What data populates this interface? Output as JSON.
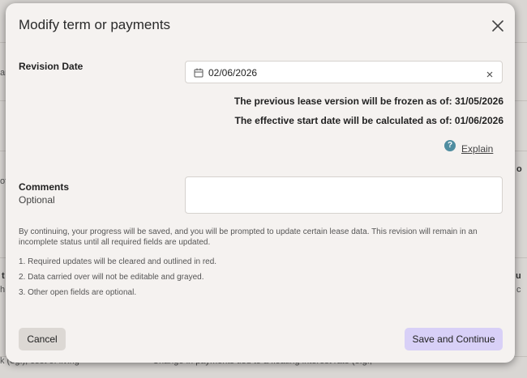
{
  "background": {
    "fragments": [
      "ar",
      "of",
      "t",
      "h",
      "o",
      "u",
      "c",
      "k (eg.), cost of living",
      "Change in payments tied to a floating interest rate (e.g.,"
    ]
  },
  "modal": {
    "title": "Modify term or payments",
    "close_icon": "close-icon",
    "revision_date": {
      "label": "Revision Date",
      "value": "02/06/2026",
      "icon": "calendar-icon",
      "clear_icon": "clear-icon"
    },
    "info": {
      "frozen_text": "The previous lease version will be frozen as of: 31/05/2026",
      "effective_text": "The effective start date will be calculated as of: 01/06/2026"
    },
    "help": {
      "icon_glyph": "?",
      "link_label": "Explain"
    },
    "comments": {
      "label": "Comments",
      "sublabel": "Optional",
      "value": ""
    },
    "disclaimer": "By continuing, your progress will be saved, and you will be prompted to update certain lease data. This revision will remain in an incomplete status until all required fields are updated.",
    "notes": [
      "1. Required updates will be cleared and outlined in red.",
      "2. Data carried over will not be editable and grayed.",
      "3. Other open fields are optional."
    ],
    "buttons": {
      "cancel": "Cancel",
      "save": "Save and Continue"
    },
    "colors": {
      "accent_button": "#d8d0f7",
      "help_icon": "#4f8da0"
    }
  }
}
